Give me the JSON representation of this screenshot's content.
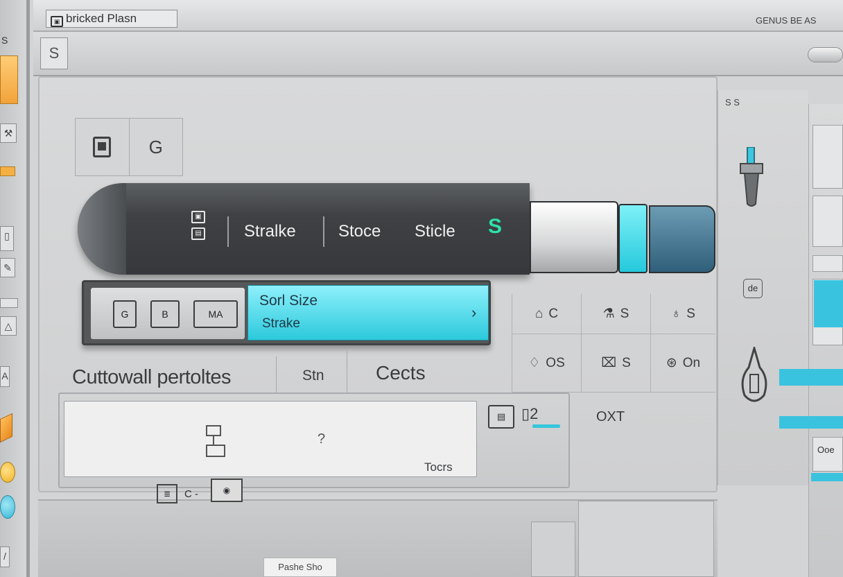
{
  "window": {
    "title": "bricked Plasn",
    "title_icon": "app-logo-icon",
    "top_right_text": "GENUS BE AS"
  },
  "toolbar": {
    "s_tool_glyph": "S"
  },
  "icon_pair": {
    "left_icon": "document-icon",
    "right_glyph": "G"
  },
  "stroke_bar": {
    "segments": [
      "Stralke",
      "Stoce",
      "Sticle"
    ],
    "small_icons": [
      "document-icon",
      "layers-icon"
    ],
    "green_glyph": "S",
    "colors": {
      "dark": "#3f4144",
      "white": "#f2f2f2",
      "cyan": "#2cc9dc",
      "teal": "#3e6f8c",
      "green": "#2de0a8"
    }
  },
  "font_row": {
    "icons": [
      "G",
      "B",
      "MA"
    ],
    "font_size_label": "Sorl Size",
    "strake_label": "Strake",
    "arrow": "›"
  },
  "symbol_grid": {
    "row1": [
      "C",
      "S",
      "S"
    ],
    "row2": [
      "OS",
      "S",
      "On"
    ]
  },
  "lower_row": {
    "title": "Cuttowall pertoltes",
    "stn": "Stn",
    "cects": "Cects"
  },
  "input": {
    "value": "",
    "question_glyph": "?",
    "btn2_glyph": "2"
  },
  "labels": {
    "tocrs": "Tocrs",
    "ox": "OXT",
    "bottom_icons_text": "C -",
    "bottom_tag": "Pashe Sho"
  },
  "right_panel": {
    "tab_text": "S  S",
    "de_glyph": "de",
    "far_right_text": "Ooe"
  }
}
